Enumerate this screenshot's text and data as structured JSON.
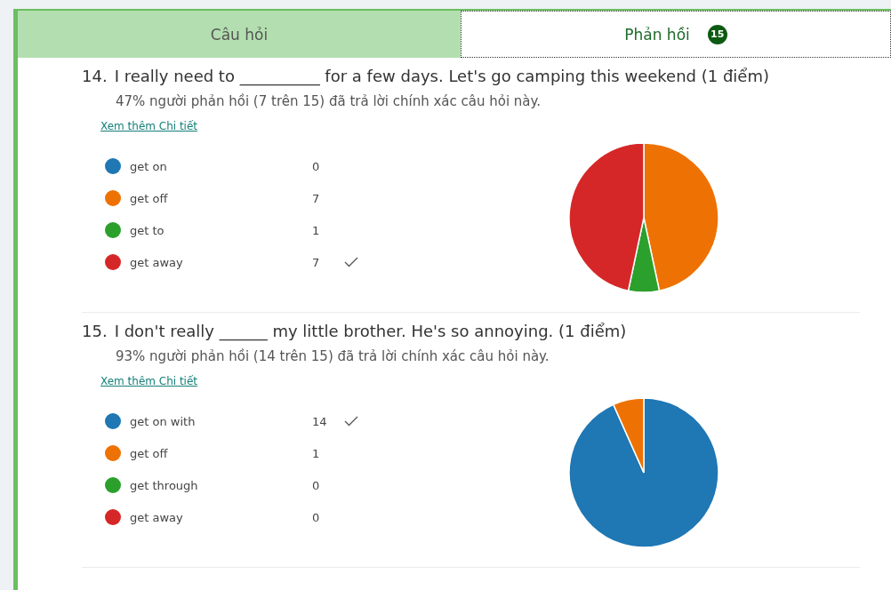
{
  "tabs": [
    {
      "label": "Câu hỏi",
      "selected": false
    },
    {
      "label": "Phản hồi",
      "badge": "15",
      "selected": true
    }
  ],
  "questions": [
    {
      "number": "14.",
      "text": "I really need to  __________ for a few days. Let's go camping this weekend (1 điểm)",
      "summary": "47% người phản hồi (7 trên 15) đã trả lời chính xác câu hỏi này.",
      "link": "Xem thêm Chi tiết",
      "options": [
        {
          "label": "get on",
          "count": "0",
          "color": "#1f77b4",
          "correct": false
        },
        {
          "label": "get off",
          "count": "7",
          "color": "#ee7203",
          "correct": false
        },
        {
          "label": "get to",
          "count": "1",
          "color": "#2ca02c",
          "correct": false
        },
        {
          "label": "get away",
          "count": "7",
          "color": "#d62728",
          "correct": true
        }
      ],
      "chart_data": {
        "type": "pie",
        "values": [
          0,
          46.67,
          6.66,
          46.67
        ]
      }
    },
    {
      "number": "15.",
      "text": "I don't really ______ my little brother. He's so annoying.  (1 điểm)",
      "summary": "93% người phản hồi (14 trên 15) đã trả lời chính xác câu hỏi này.",
      "link": "Xem thêm Chi tiết",
      "options": [
        {
          "label": "get on with",
          "count": "14",
          "color": "#1f77b4",
          "correct": true
        },
        {
          "label": "get off",
          "count": "1",
          "color": "#ee7203",
          "correct": false
        },
        {
          "label": "get through",
          "count": "0",
          "color": "#2ca02c",
          "correct": false
        },
        {
          "label": "get away",
          "count": "0",
          "color": "#d62728",
          "correct": false
        }
      ],
      "chart_data": {
        "type": "pie",
        "values": [
          93.33,
          6.67,
          0,
          0
        ]
      }
    }
  ]
}
